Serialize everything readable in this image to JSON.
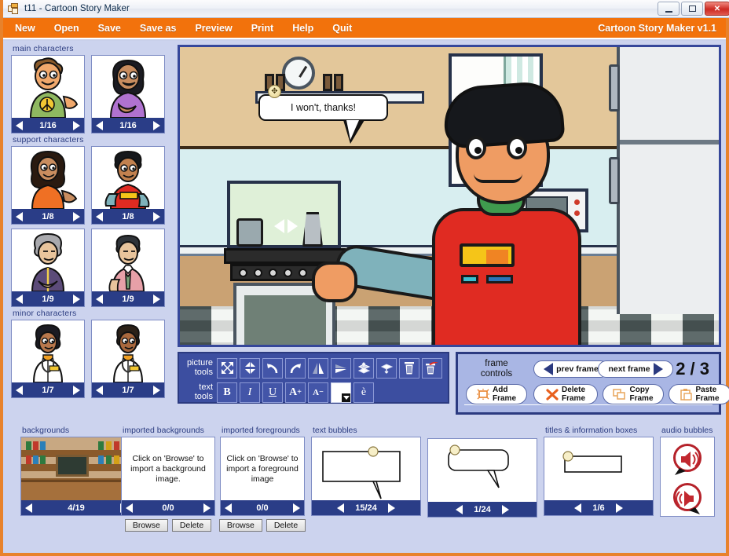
{
  "window": {
    "title": "t11 - Cartoon Story Maker",
    "icon": "app-window-icon",
    "minimize": "minimize-icon",
    "maximize": "maximize-icon",
    "close": "close-icon"
  },
  "menubar": {
    "items": [
      {
        "label": "New",
        "name": "menu-new"
      },
      {
        "label": "Open",
        "name": "menu-open"
      },
      {
        "label": "Save",
        "name": "menu-save"
      },
      {
        "label": "Save as",
        "name": "menu-save-as"
      },
      {
        "label": "Preview",
        "name": "menu-preview"
      },
      {
        "label": "Print",
        "name": "menu-print"
      },
      {
        "label": "Help",
        "name": "menu-help"
      },
      {
        "label": "Quit",
        "name": "menu-quit"
      }
    ],
    "brand": "Cartoon Story Maker v1.1"
  },
  "characters": {
    "groups": [
      {
        "label": "main characters",
        "items": [
          {
            "counter": "1/16",
            "alt": "boy-green-shirt-thumbnail"
          },
          {
            "counter": "1/16",
            "alt": "girl-purple-shirt-thumbnail"
          }
        ]
      },
      {
        "label": "support characters",
        "items": [
          {
            "counter": "1/8",
            "alt": "woman-orange-top-thumbnail"
          },
          {
            "counter": "1/8",
            "alt": "boy-red-shirt-thumbnail"
          }
        ]
      },
      {
        "label": "",
        "items": [
          {
            "counter": "1/9",
            "alt": "older-woman-purple-jacket-thumbnail"
          },
          {
            "counter": "1/9",
            "alt": "man-pink-shirt-tie-thumbnail"
          }
        ]
      },
      {
        "label": "minor characters",
        "items": [
          {
            "counter": "1/7",
            "alt": "female-doctor-thumbnail"
          },
          {
            "counter": "1/7",
            "alt": "male-doctor-thumbnail"
          }
        ]
      }
    ]
  },
  "stage": {
    "speech_bubble_text": "I won't, thanks!",
    "scene_alt": "kitchen-scene-with-boy"
  },
  "picture_tools": {
    "label_line1": "picture",
    "label_line2": "tools",
    "buttons": [
      {
        "name": "enlarge-icon",
        "title": "enlarge"
      },
      {
        "name": "shrink-icon",
        "title": "shrink"
      },
      {
        "name": "undo-icon",
        "title": "undo"
      },
      {
        "name": "redo-icon",
        "title": "redo"
      },
      {
        "name": "flip-horizontal-icon",
        "title": "flip horizontal"
      },
      {
        "name": "flip-vertical-icon",
        "title": "flip vertical"
      },
      {
        "name": "bring-to-front-icon",
        "title": "bring to front"
      },
      {
        "name": "send-to-back-icon",
        "title": "send to back"
      },
      {
        "name": "delete-item-icon",
        "title": "delete item"
      },
      {
        "name": "delete-all-icon",
        "title": "delete all"
      }
    ]
  },
  "text_tools": {
    "label_line1": "text",
    "label_line2": "tools",
    "buttons": [
      {
        "name": "bold-icon",
        "glyph": "B"
      },
      {
        "name": "italic-icon",
        "glyph": "I"
      },
      {
        "name": "underline-icon",
        "glyph": "U"
      },
      {
        "name": "increase-font-size-icon",
        "glyph": "A"
      },
      {
        "name": "decrease-font-size-icon",
        "glyph": "A"
      },
      {
        "name": "text-color-picker",
        "glyph": ""
      },
      {
        "name": "accent-character-icon",
        "glyph": "è"
      }
    ]
  },
  "frame_controls": {
    "label_line1": "frame",
    "label_line2": "controls",
    "prev_frame": "prev frame",
    "next_frame": "next frame",
    "counter": "2 / 3",
    "add_frame_line1": "Add",
    "add_frame_line2": "Frame",
    "delete_frame_line1": "Delete",
    "delete_frame_line2": "Frame",
    "copy_frame_line1": "Copy",
    "copy_frame_line2": "Frame",
    "paste_frame_line1": "Paste",
    "paste_frame_line2": "Frame"
  },
  "library": {
    "backgrounds": {
      "label": "backgrounds",
      "counter": "4/19",
      "alt": "grocery-store-background-thumbnail"
    },
    "imported_backgrounds": {
      "label": "imported backgrounds",
      "message": "Click on 'Browse' to import a background image.",
      "counter": "0/0",
      "browse": "Browse",
      "delete": "Delete"
    },
    "imported_foregrounds": {
      "label": "imported foregrounds",
      "message": "Click on 'Browse' to import a foreground image",
      "counter": "0/0",
      "browse": "Browse",
      "delete": "Delete"
    },
    "text_bubbles": {
      "label": "text bubbles",
      "slot1_counter": "15/24",
      "slot2_counter": "1/24"
    },
    "titles_info_boxes": {
      "label": "titles & information boxes",
      "counter": "1/6"
    },
    "audio_bubbles": {
      "label": "audio bubbles",
      "item1": "audio-bubble-right-icon",
      "item2": "audio-bubble-left-icon"
    }
  },
  "colors": {
    "accent_orange": "#f2720c",
    "panel_blue": "#3c4ea0",
    "nav_blue": "#2a3d87",
    "body_lavender": "#ccd3ee",
    "frame_panel": "#a9b6e4"
  }
}
